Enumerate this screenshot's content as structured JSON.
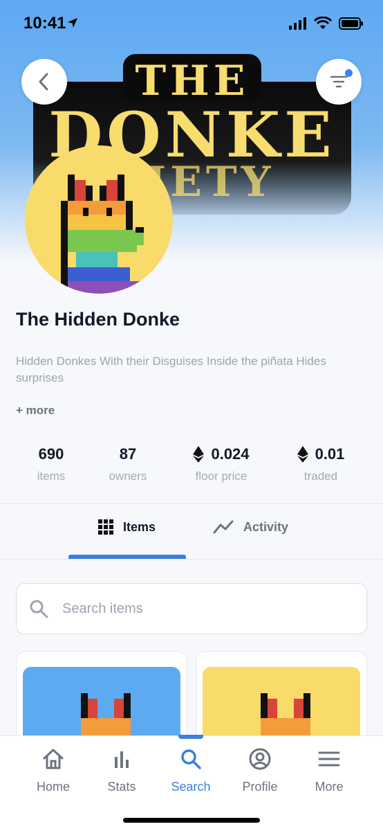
{
  "status_bar": {
    "time": "10:41"
  },
  "banner": {
    "logo_line1": "THE",
    "logo_line2": "DONKE",
    "logo_line3": "CIETY"
  },
  "collection": {
    "title": "The Hidden Donke",
    "description": "Hidden Donkes With their Disguises Inside the piñata Hides surprises",
    "more_label": "+ more"
  },
  "stats": [
    {
      "value": "690",
      "label": "items",
      "eth": false
    },
    {
      "value": "87",
      "label": "owners",
      "eth": false
    },
    {
      "value": "0.024",
      "label": "floor price",
      "eth": true
    },
    {
      "value": "0.01",
      "label": "traded",
      "eth": true
    }
  ],
  "tabs": [
    {
      "label": "Items",
      "icon": "grid-icon",
      "active": true
    },
    {
      "label": "Activity",
      "icon": "chart-line-icon",
      "active": false
    }
  ],
  "search": {
    "placeholder": "Search items"
  },
  "cards": [
    {
      "background": "#5eaaf0"
    },
    {
      "background": "#f8db6a"
    }
  ],
  "bottom_nav": [
    {
      "label": "Home",
      "icon": "home-icon",
      "active": false
    },
    {
      "label": "Stats",
      "icon": "bar-chart-icon",
      "active": false
    },
    {
      "label": "Search",
      "icon": "search-icon",
      "active": true
    },
    {
      "label": "Profile",
      "icon": "user-circle-icon",
      "active": false
    },
    {
      "label": "More",
      "icon": "menu-icon",
      "active": false
    }
  ],
  "colors": {
    "accent": "#3b7fe0",
    "avatar_bg": "#f8db6a",
    "logo_yellow": "#f7dc6f"
  }
}
